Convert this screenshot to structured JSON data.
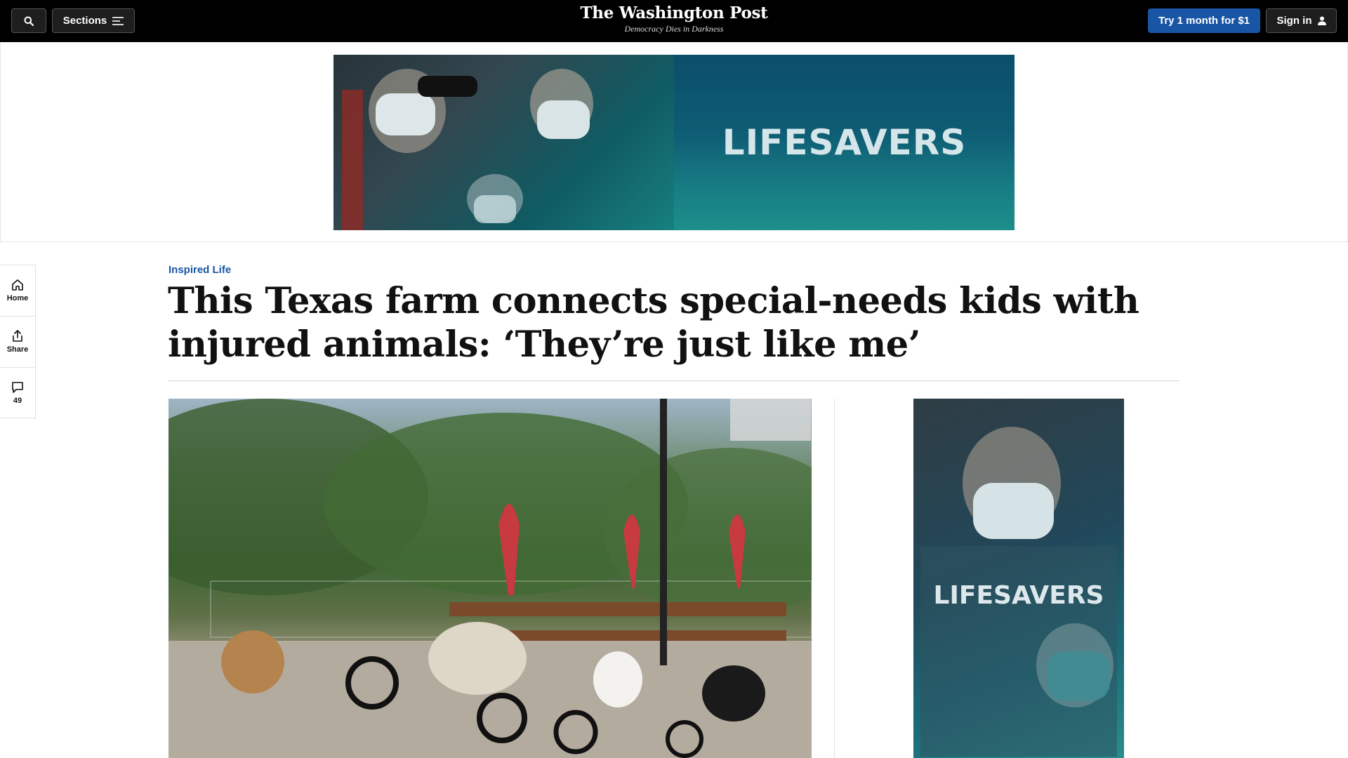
{
  "topbar": {
    "search_icon": "search-icon",
    "sections_label": "Sections",
    "sections_icon": "menu-lines-icon",
    "logo_title": "The Washington Post",
    "logo_tagline": "Democracy Dies in Darkness",
    "trial_label": "Try 1 month for $1",
    "signin_label": "Sign in",
    "signin_icon": "user-icon",
    "accent_color": "#1955a5"
  },
  "top_ad": {
    "text": "LIFESAVERS"
  },
  "rail": {
    "items": [
      {
        "label": "Home",
        "icon": "home-icon"
      },
      {
        "label": "Share",
        "icon": "share-icon"
      },
      {
        "label": "49",
        "icon": "comment-icon"
      }
    ]
  },
  "article": {
    "kicker": "Inspired Life",
    "headline": "This Texas farm connects special-needs kids with injured animals: ‘They’re just like me’"
  },
  "side_ad": {
    "text": "LIFESAVERS"
  }
}
